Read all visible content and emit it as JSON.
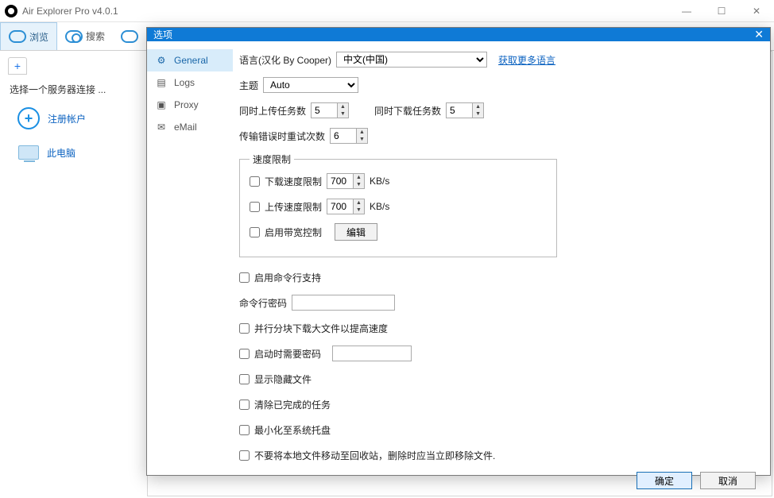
{
  "window": {
    "title": "Air Explorer Pro v4.0.1"
  },
  "toolbar": {
    "browse": "浏览",
    "search": "搜索"
  },
  "sidebar": {
    "hint": "选择一个服务器连接 ...",
    "register": "注册帐户",
    "thispc": "此电脑"
  },
  "dialog": {
    "title": "选项",
    "nav": {
      "general": "General",
      "logs": "Logs",
      "proxy": "Proxy",
      "email": "eMail"
    },
    "language_label": "语言(汉化 By Cooper)",
    "language_value": "中文(中国)",
    "get_more_lang": "获取更多语言",
    "theme_label": "主题",
    "theme_value": "Auto",
    "upload_tasks_label": "同时上传任务数",
    "upload_tasks_value": "5",
    "download_tasks_label": "同时下载任务数",
    "download_tasks_value": "5",
    "retry_label": "传输错误时重试次数",
    "retry_value": "6",
    "speed_group": "速度限制",
    "dl_limit_label": "下载速度限制",
    "dl_limit_value": "700",
    "ul_limit_label": "上传速度限制",
    "ul_limit_value": "700",
    "unit": "KB/s",
    "bandwidth_label": "启用带宽控制",
    "edit_btn": "编辑",
    "enable_cli": "启用命令行支持",
    "cli_pwd_label": "命令行密码",
    "parallel_chunk": "并行分块下载大文件以提高速度",
    "startup_pwd": "启动时需要密码",
    "show_hidden": "显示隐藏文件",
    "clear_done": "清除已完成的任务",
    "min_tray": "最小化至系统托盘",
    "no_recycle": "不要将本地文件移动至回收站，删除时应当立即移除文件.",
    "ok": "确定",
    "cancel": "取消"
  }
}
